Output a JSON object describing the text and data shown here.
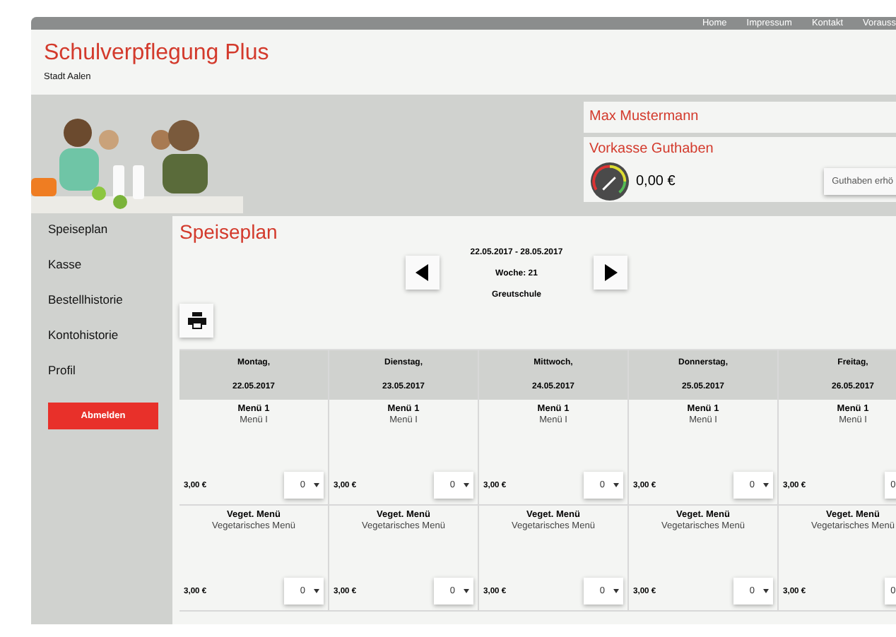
{
  "top_nav": [
    {
      "label": "Home"
    },
    {
      "label": "Impressum"
    },
    {
      "label": "Kontakt"
    },
    {
      "label": "Vorauss"
    }
  ],
  "header": {
    "title": "Schulverpflegung Plus",
    "subtitle": "Stadt Aalen"
  },
  "account": {
    "user_name": "Max Mustermann",
    "balance_title": "Vorkasse Guthaben",
    "balance": "0,00 €",
    "topup_button": "Guthaben erhö"
  },
  "sidebar": {
    "items": [
      {
        "label": "Speiseplan"
      },
      {
        "label": "Kasse"
      },
      {
        "label": "Bestellhistorie"
      },
      {
        "label": "Kontohistorie"
      },
      {
        "label": "Profil"
      }
    ],
    "logout_button": "Abmelden"
  },
  "content": {
    "title": "Speiseplan",
    "date_range": "22.05.2017 - 28.05.2017",
    "week": "Woche: 21",
    "school": "Greutschule"
  },
  "days": [
    {
      "weekday": "Montag,",
      "date": "22.05.2017",
      "meals": [
        {
          "name": "Menü 1",
          "description": "Menü I",
          "price": "3,00 €",
          "quantity": "0"
        },
        {
          "name": "Veget. Menü",
          "description": "Vegetarisches Menü",
          "price": "3,00 €",
          "quantity": "0"
        }
      ]
    },
    {
      "weekday": "Dienstag,",
      "date": "23.05.2017",
      "meals": [
        {
          "name": "Menü 1",
          "description": "Menü I",
          "price": "3,00 €",
          "quantity": "0"
        },
        {
          "name": "Veget. Menü",
          "description": "Vegetarisches Menü",
          "price": "3,00 €",
          "quantity": "0"
        }
      ]
    },
    {
      "weekday": "Mittwoch,",
      "date": "24.05.2017",
      "meals": [
        {
          "name": "Menü 1",
          "description": "Menü I",
          "price": "3,00 €",
          "quantity": "0"
        },
        {
          "name": "Veget. Menü",
          "description": "Vegetarisches Menü",
          "price": "3,00 €",
          "quantity": "0"
        }
      ]
    },
    {
      "weekday": "Donnerstag,",
      "date": "25.05.2017",
      "meals": [
        {
          "name": "Menü 1",
          "description": "Menü I",
          "price": "3,00 €",
          "quantity": "0"
        },
        {
          "name": "Veget. Menü",
          "description": "Vegetarisches Menü",
          "price": "3,00 €",
          "quantity": "0"
        }
      ]
    },
    {
      "weekday": "Freitag,",
      "date": "26.05.2017",
      "meals": [
        {
          "name": "Menü 1",
          "description": "Menü I",
          "price": "3,00 €",
          "quantity": "0"
        },
        {
          "name": "Veget. Menü",
          "description": "Vegetarisches Menü",
          "price": "3,00 €",
          "quantity": "0"
        }
      ]
    }
  ]
}
